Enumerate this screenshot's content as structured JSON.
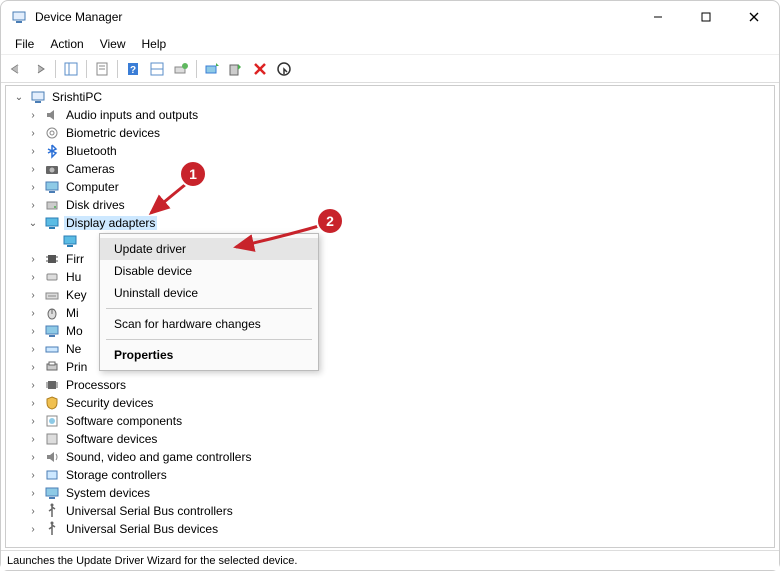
{
  "window": {
    "title": "Device Manager"
  },
  "menu": {
    "file": "File",
    "action": "Action",
    "view": "View",
    "help": "Help"
  },
  "tree": {
    "root": "SrishtiPC",
    "items": [
      {
        "label": "Audio inputs and outputs"
      },
      {
        "label": "Biometric devices"
      },
      {
        "label": "Bluetooth"
      },
      {
        "label": "Cameras"
      },
      {
        "label": "Computer"
      },
      {
        "label": "Disk drives"
      },
      {
        "label": "Display adapters",
        "expanded": true
      },
      {
        "label": "Firr"
      },
      {
        "label": "Hu"
      },
      {
        "label": "Key"
      },
      {
        "label": "Mi"
      },
      {
        "label": "Mo"
      },
      {
        "label": "Ne"
      },
      {
        "label": "Prin"
      },
      {
        "label": "Processors"
      },
      {
        "label": "Security devices"
      },
      {
        "label": "Software components"
      },
      {
        "label": "Software devices"
      },
      {
        "label": "Sound, video and game controllers"
      },
      {
        "label": "Storage controllers"
      },
      {
        "label": "System devices"
      },
      {
        "label": "Universal Serial Bus controllers"
      },
      {
        "label": "Universal Serial Bus devices"
      }
    ]
  },
  "context_menu": {
    "update_driver": "Update driver",
    "disable_device": "Disable device",
    "uninstall_device": "Uninstall device",
    "scan": "Scan for hardware changes",
    "properties": "Properties"
  },
  "statusbar": {
    "text": "Launches the Update Driver Wizard for the selected device."
  },
  "callouts": {
    "one": "1",
    "two": "2"
  }
}
